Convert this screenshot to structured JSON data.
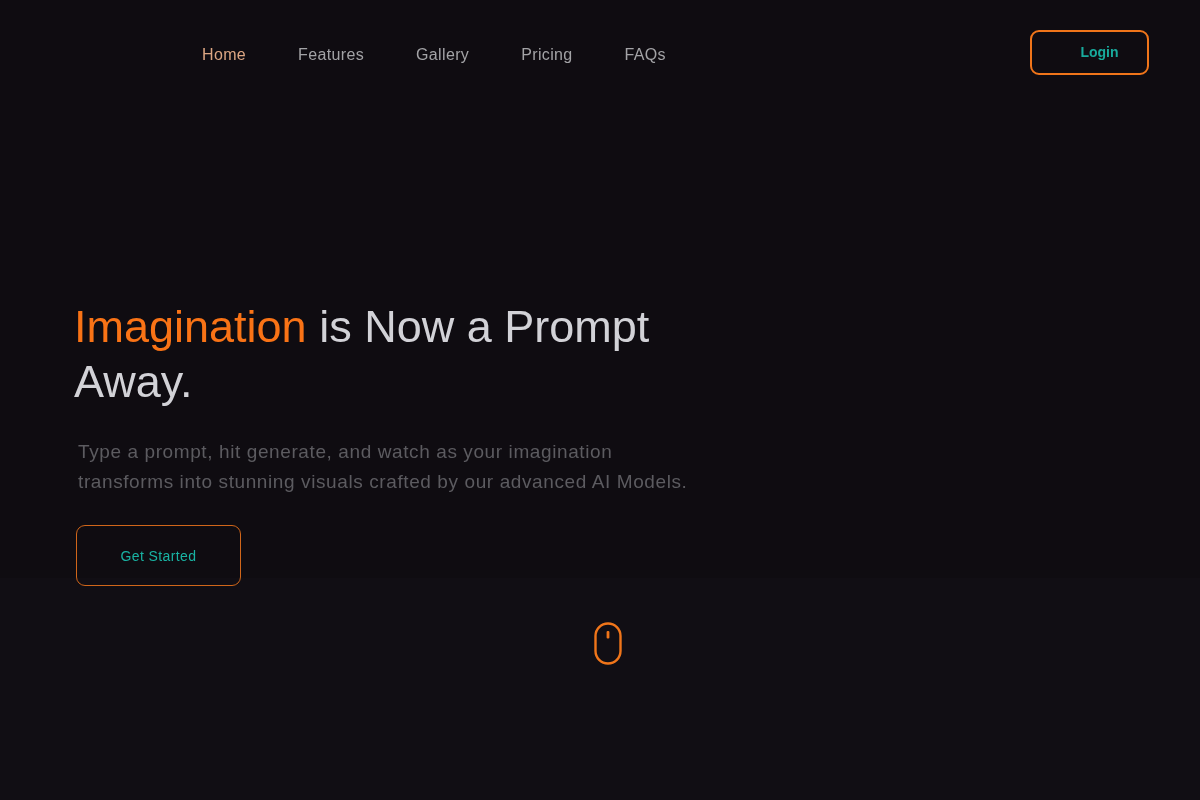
{
  "nav": {
    "links": [
      {
        "label": "Home",
        "selected": true
      },
      {
        "label": "Features",
        "selected": false
      },
      {
        "label": "Gallery",
        "selected": false
      },
      {
        "label": "Pricing",
        "selected": false
      },
      {
        "label": "FAQs",
        "selected": false
      }
    ],
    "login_button": "Login"
  },
  "hero": {
    "heading_highlight": "Imagination",
    "heading_rest": "is Now a Prompt Away.",
    "description": "Type a prompt, hit generate, and watch as your imagination transforms into stunning visuals crafted by our advanced AI Models.",
    "cta_button": "Get Started"
  }
}
